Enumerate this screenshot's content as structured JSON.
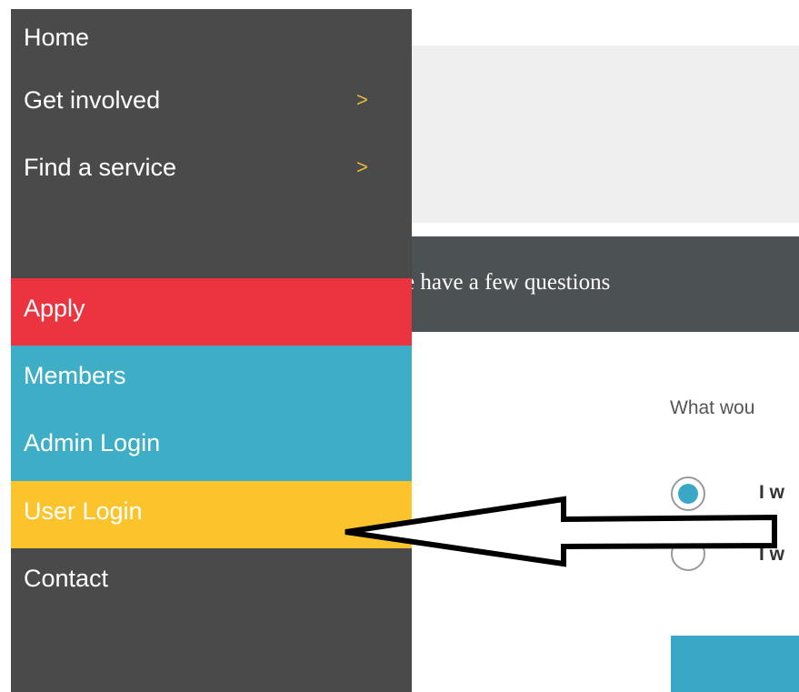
{
  "menu": {
    "items": [
      {
        "label": "Home",
        "has_submenu": false
      },
      {
        "label": "Get involved",
        "has_submenu": true
      },
      {
        "label": "Find a service",
        "has_submenu": true
      },
      {
        "label": "Apply",
        "has_submenu": false,
        "color": "#ec3340"
      },
      {
        "label": "Members",
        "has_submenu": false,
        "color": "#3eaec7"
      },
      {
        "label": "Admin Login",
        "has_submenu": false,
        "color": "#3eaec7"
      },
      {
        "label": "User Login",
        "has_submenu": false,
        "color": "#fbc42d"
      },
      {
        "label": "Contact",
        "has_submenu": false
      }
    ],
    "chevron": ">",
    "background_color": "#4a4a4a",
    "chevron_color": "#e8b93c"
  },
  "page": {
    "question_bar_text": "e have a few questions",
    "prompt_text": "What wou",
    "options": [
      {
        "label": "I w",
        "selected": true
      },
      {
        "label": "I w",
        "selected": false
      }
    ],
    "accent_color": "#3aa7c6"
  },
  "annotation": {
    "arrow_icon": "left-arrow-icon",
    "points_to": "User Login"
  }
}
